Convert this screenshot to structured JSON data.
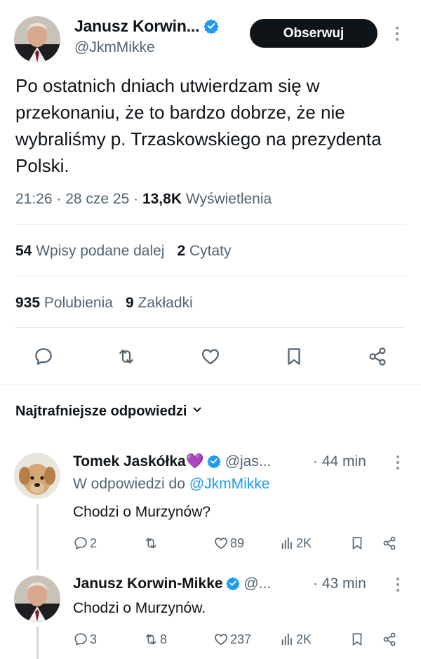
{
  "tweet": {
    "author_name": "Janusz Korwin...",
    "author_handle": "@JkmMikke",
    "follow_label": "Obserwuj",
    "text": "Po ostatnich dniach utwierdzam się w przekonaniu, że to bardzo dobrze, że nie wybraliśmy p. Trzaskowskiego na prezydenta Polski.",
    "time_date": "21:26 · 28 cze 25 · ",
    "views_count": "13,8K",
    "views_label": " Wyświetlenia",
    "reposts_count": "54",
    "reposts_label": " Wpisy podane dalej",
    "quotes_count": "2",
    "quotes_label": " Cytaty",
    "likes_count": "935",
    "likes_label": " Polubienia",
    "bookmarks_count": "9",
    "bookmarks_label": " Zakładki"
  },
  "replies_section": {
    "title": "Najtrafniejsze odpowiedzi"
  },
  "replies": [
    {
      "name": "Tomek Jaskółka💜",
      "handle": " @jas...",
      "time": "· 44 min",
      "context_prefix": "W odpowiedzi do ",
      "context_mention": "@JkmMikke",
      "text": "Chodzi o Murzynów?",
      "replies": "2",
      "reposts": "",
      "likes": "89",
      "views": "2K"
    },
    {
      "name": "Janusz Korwin-Mikke",
      "handle": " @...",
      "time": "· 43 min",
      "text": "Chodzi o Murzynów.",
      "replies": "3",
      "reposts": "8",
      "likes": "237",
      "views": "2K"
    }
  ],
  "colors": {
    "text": "#0f1419",
    "secondary": "#536471",
    "accent": "#1d9bf0",
    "verified": "#1d9bf0",
    "follow_bg": "#0f1419"
  },
  "icons": {
    "reply": "comment-icon",
    "repost": "repost-icon",
    "like": "heart-icon",
    "bookmark": "bookmark-icon",
    "share": "share-icon",
    "views": "views-icon",
    "more": "more-icon",
    "verified": "verified-badge-icon",
    "dropdown": "chevron-down-icon"
  }
}
